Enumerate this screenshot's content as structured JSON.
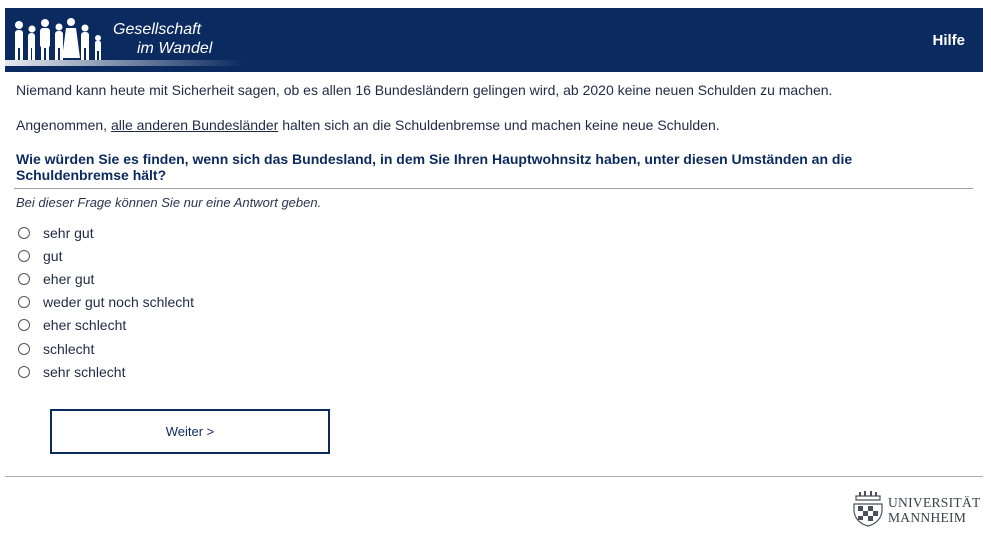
{
  "header": {
    "logo_line1": "Gesellschaft",
    "logo_line2": "im Wandel",
    "help_label": "Hilfe",
    "colors": {
      "background": "#0b2a5f",
      "text": "#ffffff"
    }
  },
  "intro": {
    "sentence1": "Niemand kann heute mit Sicherheit sagen, ob es allen 16 Bundesländern gelingen wird, ab 2020 keine neuen Schulden zu machen.",
    "sentence2_before": "Angenommen, ",
    "sentence2_link": "alle anderen Bundesländer",
    "sentence2_after": " halten sich an die Schuldenbremse und machen keine neue Schulden."
  },
  "question": {
    "text": "Wie würden Sie es finden, wenn sich das Bundesland, in dem Sie Ihren Hauptwohnsitz haben, unter diesen Umständen an die Schuldenbremse hält?",
    "instruction": "Bei dieser Frage können Sie nur eine Antwort geben.",
    "options": [
      {
        "label": "sehr gut",
        "selected": false
      },
      {
        "label": "gut",
        "selected": false
      },
      {
        "label": "eher gut",
        "selected": false
      },
      {
        "label": "weder gut noch schlecht",
        "selected": false
      },
      {
        "label": "eher schlecht",
        "selected": false
      },
      {
        "label": "schlecht",
        "selected": false
      },
      {
        "label": "sehr schlecht",
        "selected": false
      }
    ]
  },
  "navigation": {
    "next_label": "Weiter >"
  },
  "footer": {
    "university_line1": "UNIVERSITÄT",
    "university_line2": "MANNHEIM",
    "logo_icon": "university-seal-icon"
  }
}
